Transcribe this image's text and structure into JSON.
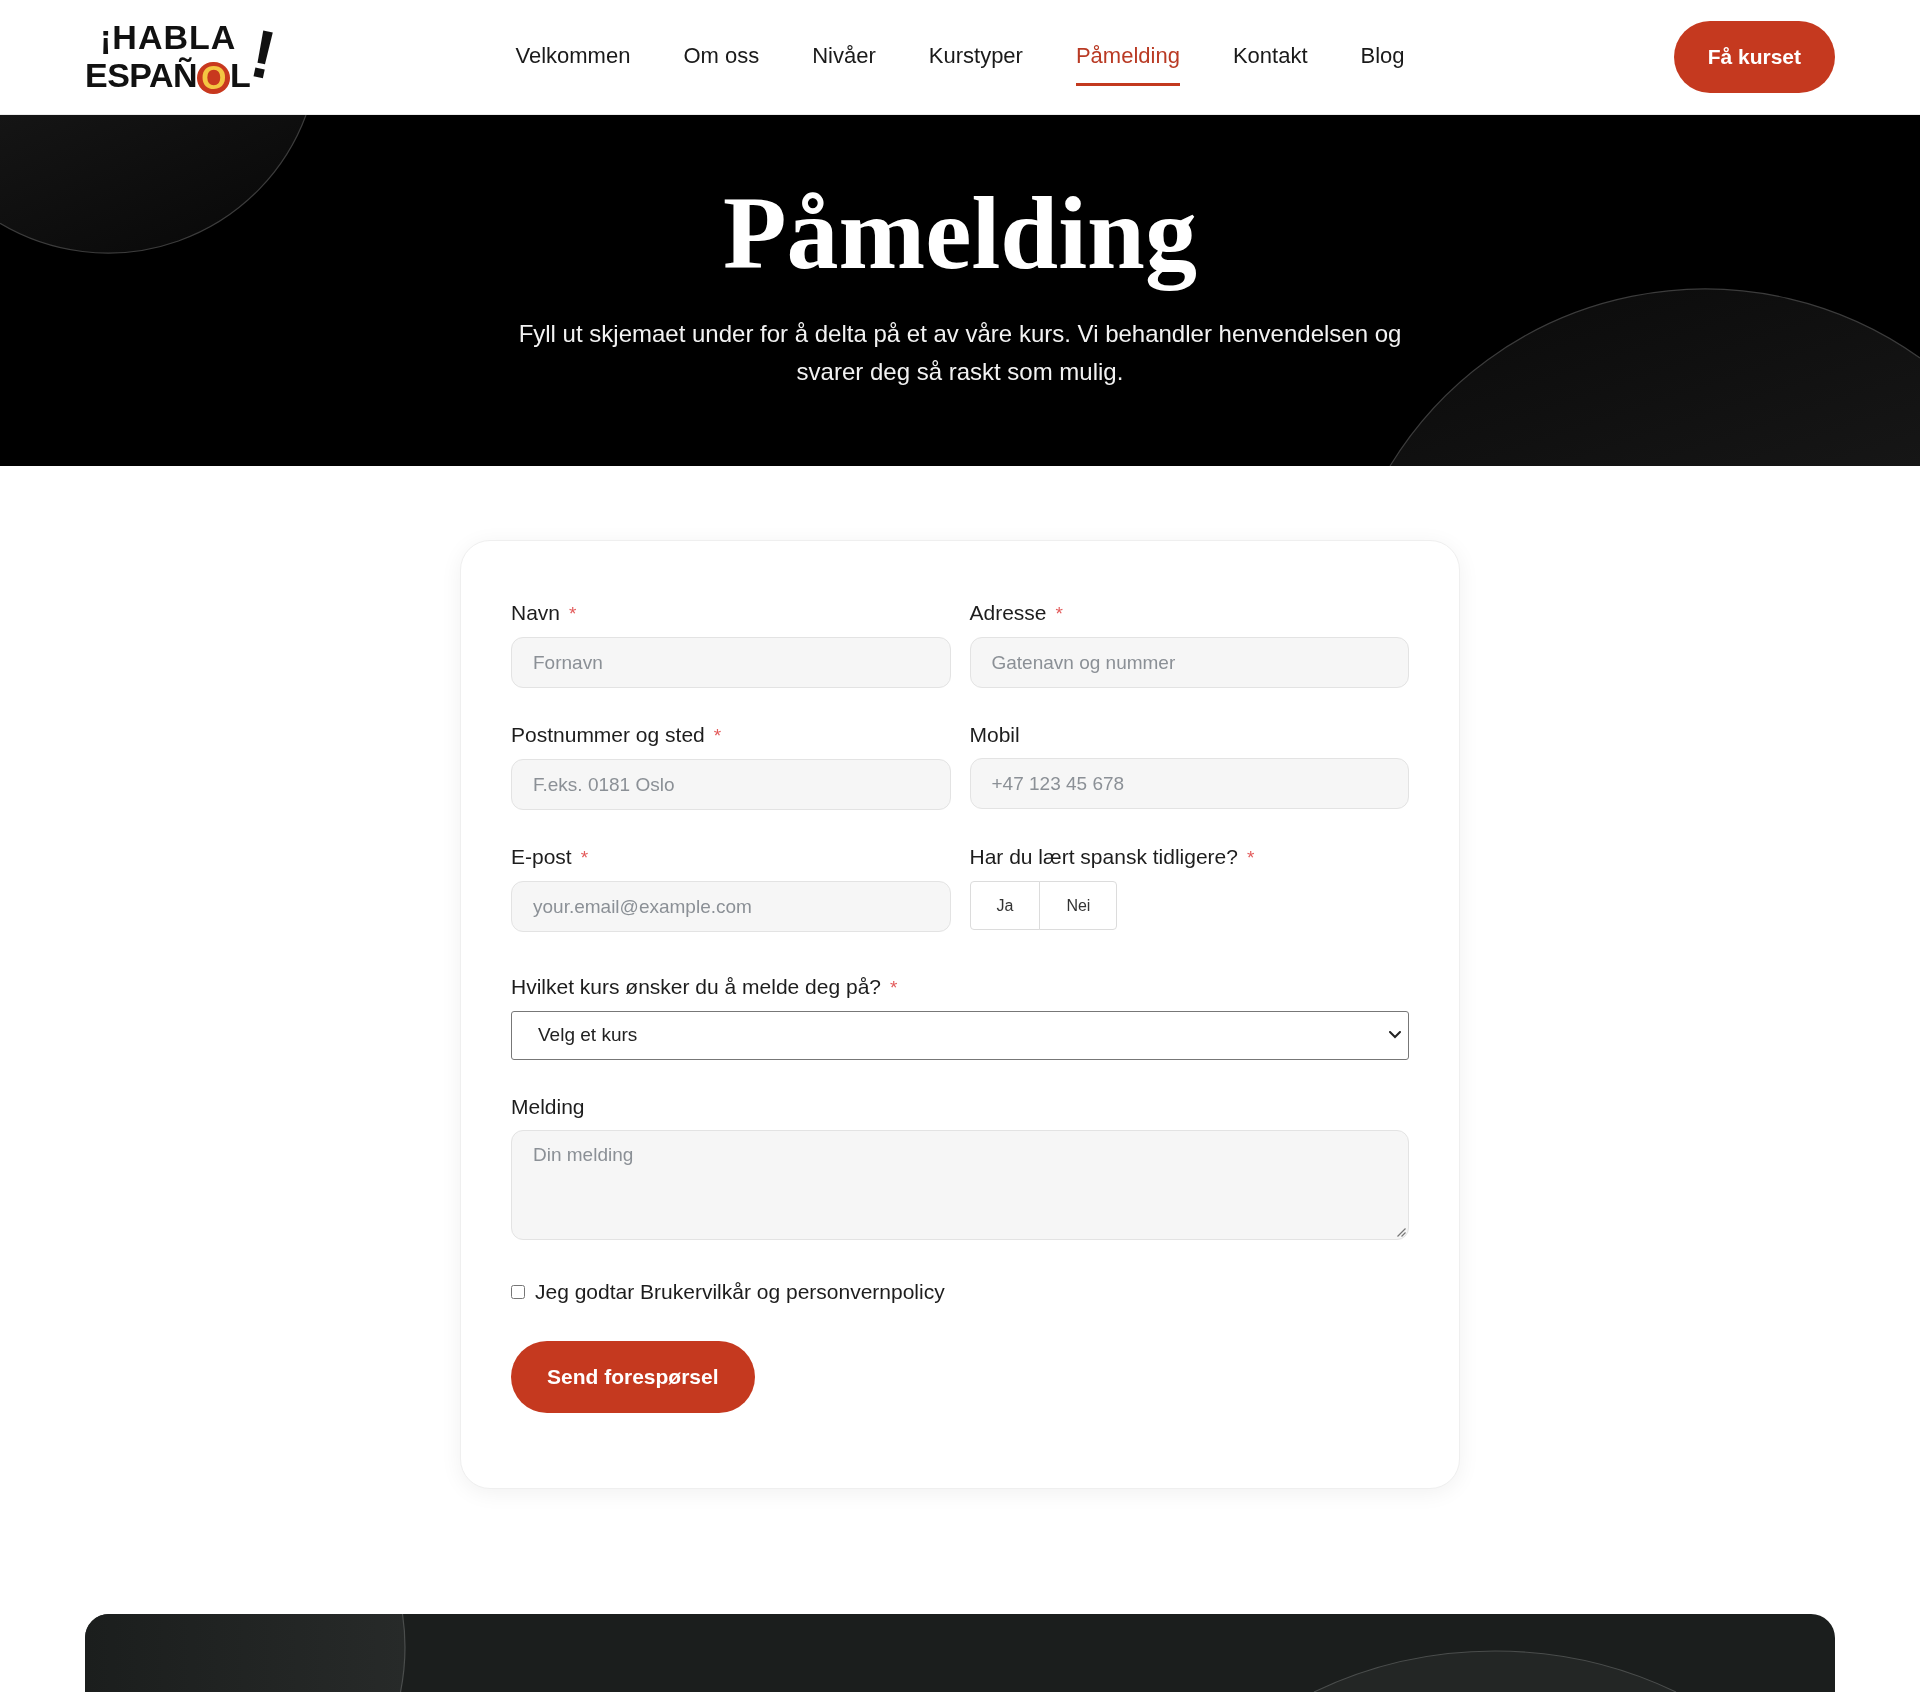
{
  "header": {
    "logo": {
      "line_1": "¡HABLA",
      "line_2_start": "ESPAÑ",
      "line_2_disc_letter": "O",
      "line_2_end": "L",
      "exclamation": "!"
    },
    "nav": [
      {
        "label": "Velkommen",
        "selected": false
      },
      {
        "label": "Om oss",
        "selected": false
      },
      {
        "label": "Nivåer",
        "selected": false
      },
      {
        "label": "Kurstyper",
        "selected": false
      },
      {
        "label": "Påmelding",
        "selected": true
      },
      {
        "label": "Kontakt",
        "selected": false
      },
      {
        "label": "Blog",
        "selected": false
      }
    ],
    "cta_button": "Få kurset"
  },
  "hero": {
    "title": "Påmelding",
    "subtitle": "Fyll ut skjemaet under for å delta på et av våre kurs. Vi behandler henvendelsen og svarer deg så raskt som mulig."
  },
  "form": {
    "fields": [
      {
        "kind": "text",
        "label": "Navn",
        "required_mark": "*",
        "placeholder": "Fornavn"
      },
      {
        "kind": "text",
        "label": "Adresse",
        "required_mark": "*",
        "placeholder": "Gatenavn og nummer"
      },
      {
        "kind": "text",
        "label": "Postnummer og sted",
        "required_mark": "*",
        "placeholder": "F.eks. 0181 Oslo"
      },
      {
        "kind": "text",
        "label": "Mobil",
        "placeholder": "+47 123 45 678"
      },
      {
        "kind": "text",
        "label": "E-post",
        "required_mark": "*",
        "placeholder": "your.email@example.com"
      },
      {
        "kind": "choice",
        "label": "Har du lært spansk tidligere?",
        "required_mark": "*",
        "options": [
          {
            "label": "Ja",
            "selected": false
          },
          {
            "label": "Nei",
            "selected": false
          }
        ]
      },
      {
        "kind": "select",
        "label": "Hvilket kurs ønsker du å melde deg på?",
        "required_mark": "*",
        "value": "Velg et kurs"
      },
      {
        "kind": "textarea",
        "label": "Melding",
        "placeholder": "Din melding"
      }
    ],
    "consent": {
      "label": "Jeg godtar Brukervilkår og personvernpolicy",
      "checked": false
    },
    "submit_button": "Send forespørsel"
  }
}
